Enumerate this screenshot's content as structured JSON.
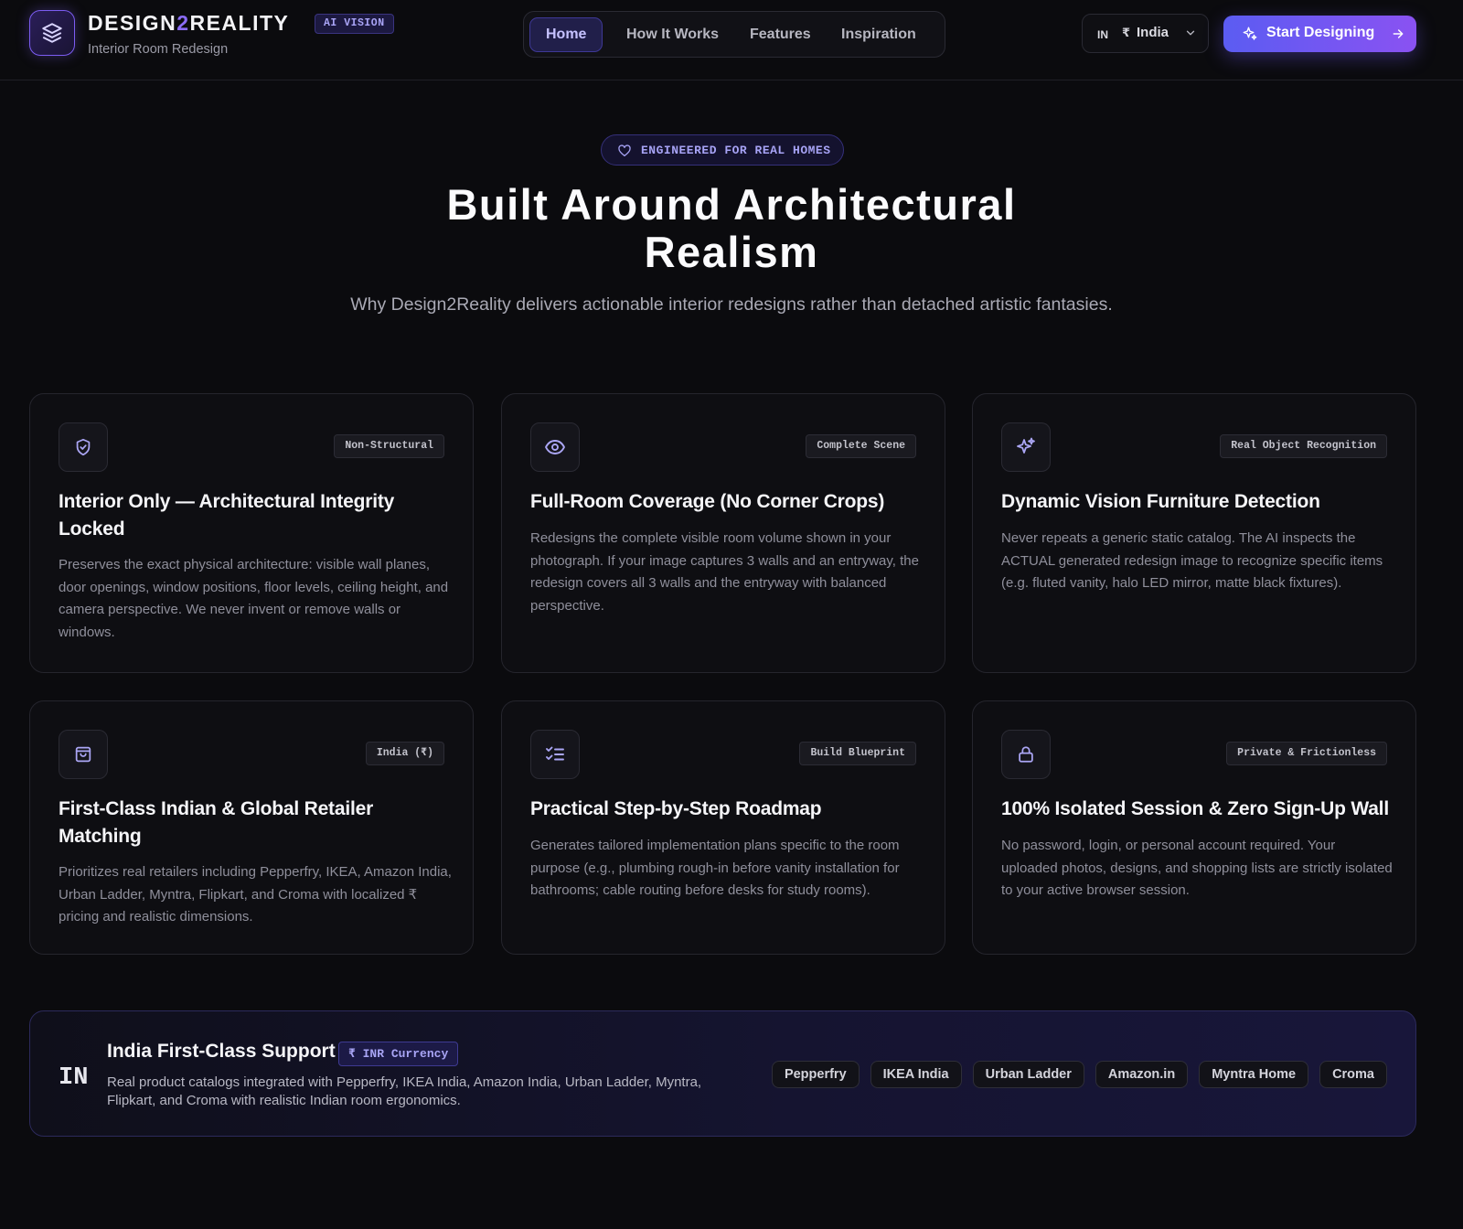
{
  "header": {
    "brand_prefix": "DESIGN",
    "brand_digit": "2",
    "brand_suffix": "REALITY",
    "ai_badge": "AI VISION",
    "subtitle": "Interior Room Redesign",
    "nav": [
      {
        "label": "Home",
        "active": true
      },
      {
        "label": "How It Works",
        "active": false
      },
      {
        "label": "Features",
        "active": false
      },
      {
        "label": "Inspiration",
        "active": false
      }
    ],
    "region": {
      "code": "IN",
      "currency_symbol": "₹",
      "name": "India"
    },
    "cta_label": "Start Designing"
  },
  "hero": {
    "badge": "ENGINEERED FOR REAL HOMES",
    "title_line1": "Built Around Architectural",
    "title_line2": "Realism",
    "subtitle": "Why Design2Reality delivers actionable interior redesigns rather than detached artistic fantasies."
  },
  "cards": [
    {
      "icon": "shield-icon",
      "tag": "Non-Structural",
      "title": "Interior Only — Architectural Integrity Locked",
      "description": "Preserves the exact physical architecture: visible wall planes, door openings, window positions, floor levels, ceiling height, and camera perspective. We never invent or remove walls or windows."
    },
    {
      "icon": "eye-icon",
      "tag": "Complete Scene",
      "title": "Full-Room Coverage (No Corner Crops)",
      "description": "Redesigns the complete visible room volume shown in your photograph. If your image captures 3 walls and an entryway, the redesign covers all 3 walls and the entryway with balanced perspective."
    },
    {
      "icon": "sparkles-icon",
      "tag": "Real Object Recognition",
      "title": "Dynamic Vision Furniture Detection",
      "description": "Never repeats a generic static catalog. The AI inspects the ACTUAL generated redesign image to recognize specific items (e.g. fluted vanity, halo LED mirror, matte black fixtures)."
    },
    {
      "icon": "shopping-bag-icon",
      "tag": "India (₹)",
      "title": "First-Class Indian & Global Retailer Matching",
      "description": "Prioritizes real retailers including Pepperfry, IKEA, Amazon India, Urban Ladder, Myntra, Flipkart, and Croma with localized ₹ pricing and realistic dimensions."
    },
    {
      "icon": "checklist-icon",
      "tag": "Build Blueprint",
      "title": "Practical Step-by-Step Roadmap",
      "description": "Generates tailored implementation plans specific to the room purpose (e.g., plumbing rough-in before vanity installation for bathrooms; cable routing before desks for study rooms)."
    },
    {
      "icon": "lock-icon",
      "tag": "Private & Frictionless",
      "title": "100% Isolated Session & Zero Sign-Up Wall",
      "description": "No password, login, or personal account required. Your uploaded photos, designs, and shopping lists are strictly isolated to your active browser session."
    }
  ],
  "support": {
    "flag": "IN",
    "title": "India First-Class Support",
    "badge": "₹ INR Currency",
    "description": "Real product catalogs integrated with Pepperfry, IKEA India, Amazon India, Urban Ladder, Myntra, Flipkart, and Croma with realistic Indian room ergonomics.",
    "retailers": [
      "Pepperfry",
      "IKEA India",
      "Urban Ladder",
      "Amazon.in",
      "Myntra Home",
      "Croma"
    ]
  },
  "colors": {
    "background": "#0b0b0e",
    "accent": "#7c5cf2",
    "accent_gradient_start": "#5b5cf2",
    "accent_gradient_end": "#8a52f2"
  }
}
